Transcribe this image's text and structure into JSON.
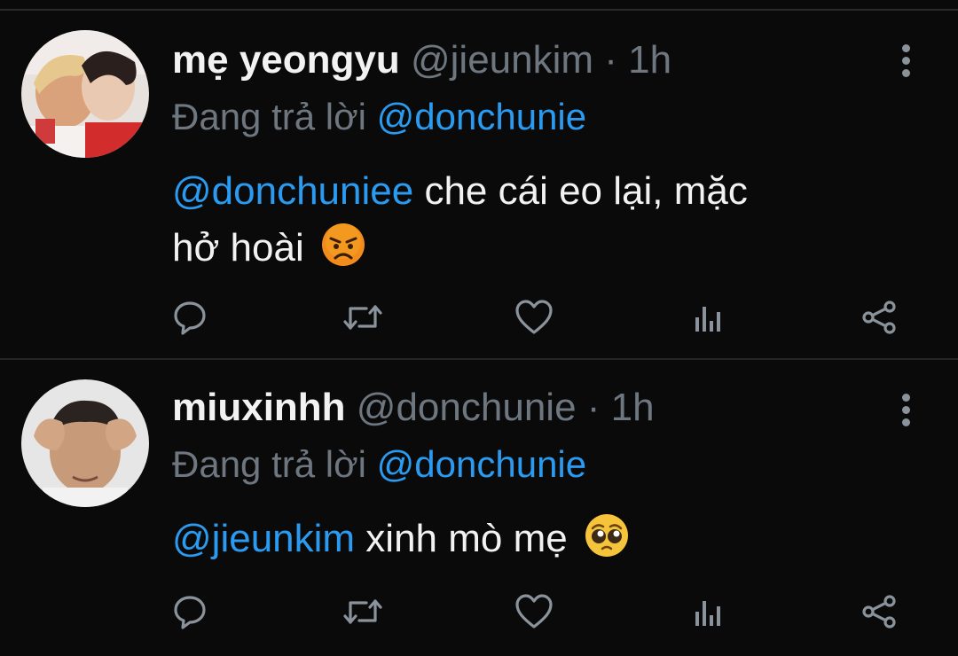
{
  "tweets": [
    {
      "name": "mẹ yeongyu",
      "handle": "@jieunkim",
      "separator": "·",
      "time": "1h",
      "reply_prefix": "Đang trả lời",
      "reply_to": "@donchunie",
      "body_mention": "@donchuniee",
      "body_line1": " che cái eo lại, mặc",
      "body_line2": "hở hoài",
      "emoji": "angry-face"
    },
    {
      "name": "miuxinhh",
      "handle": "@donchunie",
      "separator": "·",
      "time": "1h",
      "reply_prefix": "Đang trả lời",
      "reply_to": "@donchunie",
      "body_mention": "@jieunkim",
      "body_text": " xinh mò mẹ",
      "emoji": "pleading-face"
    }
  ],
  "colors": {
    "background": "#0a0a0a",
    "name": "#f2f2f2",
    "muted": "#6e7780",
    "mention": "#2a9bf0",
    "icon": "#8a939b"
  }
}
